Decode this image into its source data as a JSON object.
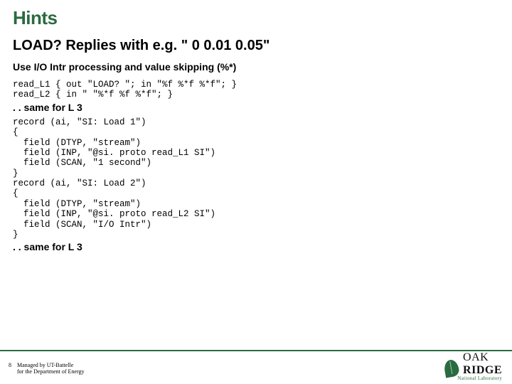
{
  "slide": {
    "title": "Hints",
    "subtitle": "LOAD? Replies with e.g. \" 0 0.01 0.05\"",
    "sub2": "Use I/O Intr processing and value skipping (%*)",
    "code1": "read_L1 { out \"LOAD? \"; in \"%f %*f %*f\"; }\nread_L2 { in \" \"%*f %f %*f\"; }",
    "note1": ". . same for L 3",
    "code2": "record (ai, \"SI: Load 1\")\n{\n  field (DTYP, \"stream\")\n  field (INP, \"@si. proto read_L1 SI\")\n  field (SCAN, \"1 second\")\n}\nrecord (ai, \"SI: Load 2\")\n{\n  field (DTYP, \"stream\")\n  field (INP, \"@si. proto read_L2 SI\")\n  field (SCAN, \"I/O Intr\")\n}",
    "note2": ". . same for L 3"
  },
  "footer": {
    "page": "8",
    "managed_l1": "Managed by UT-Battelle",
    "managed_l2": "for the Department of Energy"
  },
  "logo": {
    "oak": "OAK",
    "ridge": "RIDGE",
    "sub": "National Laboratory"
  }
}
